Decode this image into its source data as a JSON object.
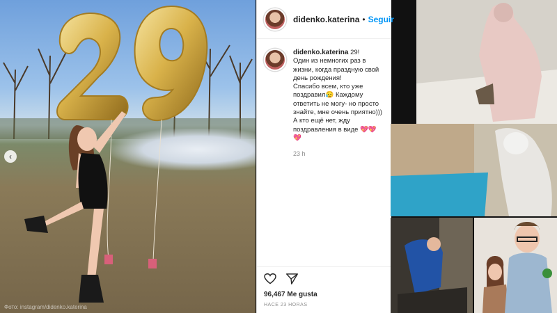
{
  "photo": {
    "balloon_digits": [
      "2",
      "9"
    ],
    "nav_icon": "chevron-left-icon",
    "watermark": "Фото: instagram/didenko.katerina"
  },
  "post": {
    "username": "didenko.katerina",
    "separator": "•",
    "follow_label": "Seguir",
    "caption_title": "29!",
    "caption_body": "Один из немногих раз в жизни, когда праздную свой день рождения!\nСпасибо всем, кто уже поздравил😥 Каждому ответить не могу- но просто знайте, мне очень приятно))) А кто ещё нет, жду поздравления в виде 💖💖💖",
    "time_short": "23 h",
    "likes": "96,467 Me gusta",
    "time_long": "HACE 23 HORAS",
    "icons": [
      "heart-icon",
      "send-icon"
    ]
  },
  "colors": {
    "link": "#0095f6",
    "text": "#262626",
    "muted": "#8e8e8e",
    "gold": "#d9b24a"
  }
}
